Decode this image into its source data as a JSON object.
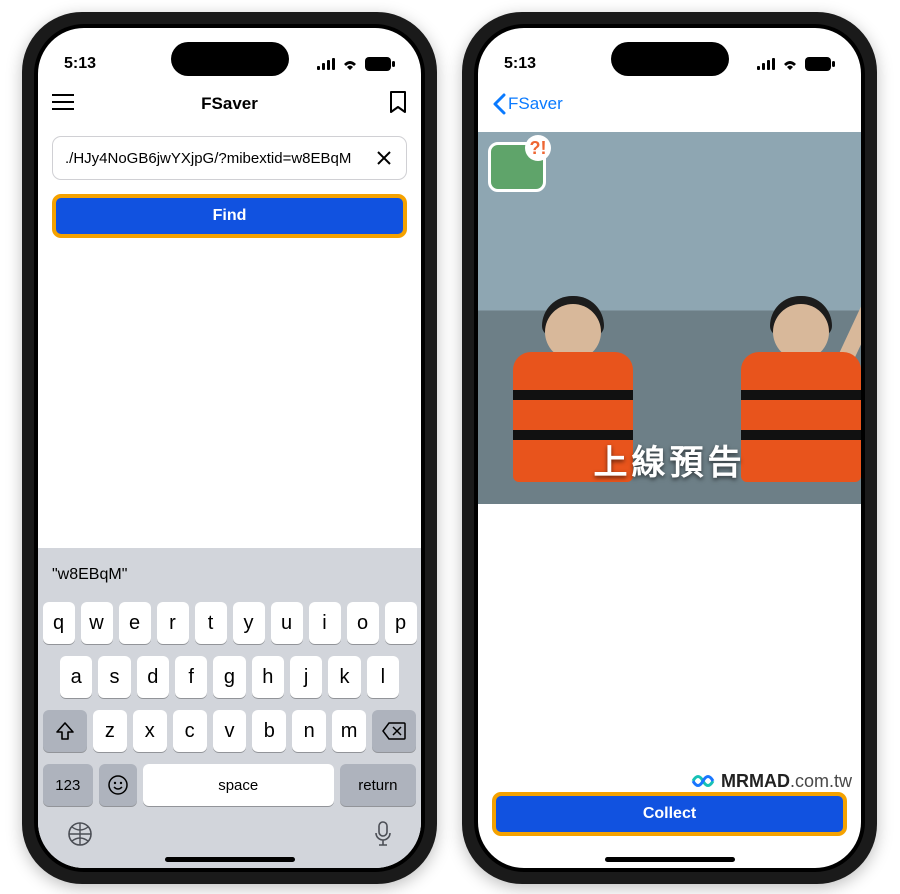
{
  "statusbar": {
    "time": "5:13",
    "battery": "77"
  },
  "left": {
    "nav": {
      "title": "FSaver"
    },
    "input": {
      "value": "./HJy4NoGB6jwYXjpG/?mibextid=w8EBqM"
    },
    "buttons": {
      "find": "Find"
    },
    "keyboard": {
      "suggestion": "\"w8EBqM\"",
      "rows": [
        [
          "q",
          "w",
          "e",
          "r",
          "t",
          "y",
          "u",
          "i",
          "o",
          "p"
        ],
        [
          "a",
          "s",
          "d",
          "f",
          "g",
          "h",
          "j",
          "k",
          "l"
        ],
        [
          "z",
          "x",
          "c",
          "v",
          "b",
          "n",
          "m"
        ]
      ],
      "keys": {
        "numbers": "123",
        "space": "space",
        "return": "return"
      }
    }
  },
  "right": {
    "nav": {
      "back": "FSaver"
    },
    "video": {
      "caption": "上線預告"
    },
    "buttons": {
      "collect": "Collect"
    }
  },
  "watermark": {
    "brand": "MRMAD",
    "domain": ".com.tw"
  }
}
